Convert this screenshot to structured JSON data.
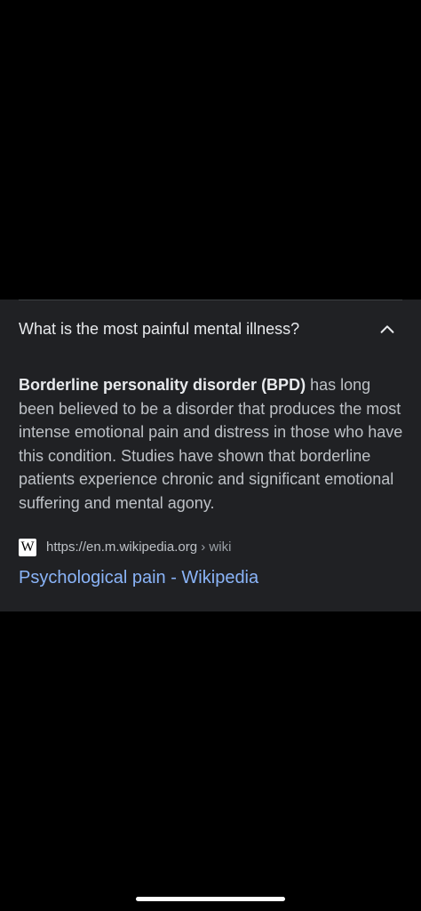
{
  "faq": {
    "question": "What is the most painful mental illness?",
    "expand_icon": "chevron-up-icon",
    "answer_bold": "Borderline personality disorder (BPD)",
    "answer_rest": " has long been believed to be a disorder that produces the most intense emotional pain and distress in those who have this condition. Studies have shown that borderline patients experience chronic and significant emotional suffering and mental agony."
  },
  "source": {
    "favicon_letter": "W",
    "url": "https://en.m.wikipedia.org",
    "breadcrumb": " › wiki",
    "title": "Psychological pain - Wikipedia"
  },
  "colors": {
    "background": "#000000",
    "card": "#202124",
    "link": "#8ab4f8"
  }
}
